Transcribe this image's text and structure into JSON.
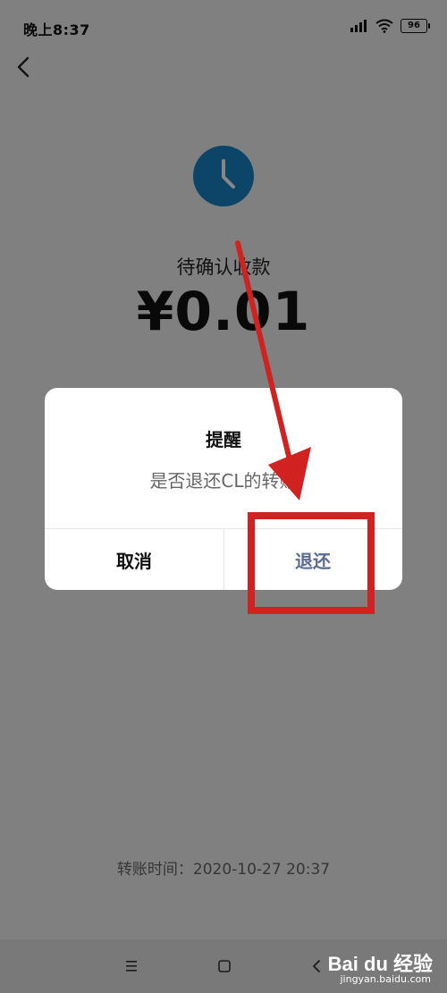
{
  "status_bar": {
    "time": "晚上8:37",
    "battery": "96"
  },
  "transfer": {
    "status": "待确认收款",
    "amount": "¥0.01",
    "time_record": "转账时间：2020-10-27 20:37"
  },
  "dialog": {
    "title": "提醒",
    "message": "是否退还CL的转账",
    "cancel_label": "取消",
    "confirm_label": "退还"
  },
  "watermark": {
    "logo": "Bai du 经验",
    "url": "jingyan.baidu.com"
  },
  "icons": {
    "back": "chevron-left-icon",
    "clock": "clock-icon",
    "signal": "signal-icon",
    "wifi": "wifi-icon",
    "battery": "battery-icon",
    "nav_menu": "menu-icon",
    "nav_home": "home-square-icon",
    "nav_back": "nav-back-icon"
  },
  "colors": {
    "clock_bg": "#1a83c6",
    "dialog_confirm_text": "#5a6c93",
    "annotation_red": "#d12222",
    "dim_overlay": "rgba(0,0,0,0.47)"
  }
}
